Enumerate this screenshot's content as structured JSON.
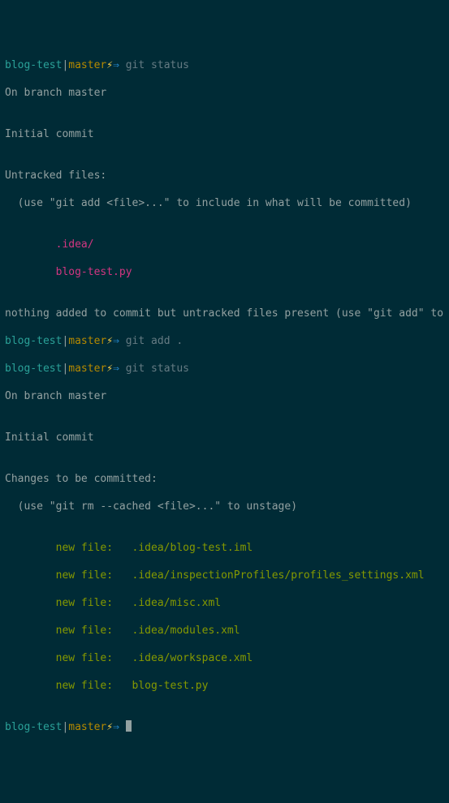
{
  "prompt": {
    "dir": "blog-test",
    "sep1": "|",
    "branch": "master",
    "bolt": "⚡",
    "arrow": "⇒"
  },
  "cmd": {
    "status": "git status",
    "add": "git add .",
    "empty": ""
  },
  "status1": {
    "on_branch": "On branch master",
    "blank": "",
    "initial": "Initial commit",
    "untracked_header": "Untracked files:",
    "untracked_hint": "  (use \"git add <file>...\" to include in what will be committed)",
    "files": [
      "        .idea/",
      "        blog-test.py"
    ],
    "nothing_added": "nothing added to commit but untracked files present (use \"git add\" to track)"
  },
  "status2": {
    "on_branch": "On branch master",
    "blank": "",
    "initial": "Initial commit",
    "changes_header": "Changes to be committed:",
    "changes_hint": "  (use \"git rm --cached <file>...\" to unstage)",
    "files": [
      "        new file:   .idea/blog-test.iml",
      "        new file:   .idea/inspectionProfiles/profiles_settings.xml",
      "        new file:   .idea/misc.xml",
      "        new file:   .idea/modules.xml",
      "        new file:   .idea/workspace.xml",
      "        new file:   blog-test.py"
    ]
  }
}
